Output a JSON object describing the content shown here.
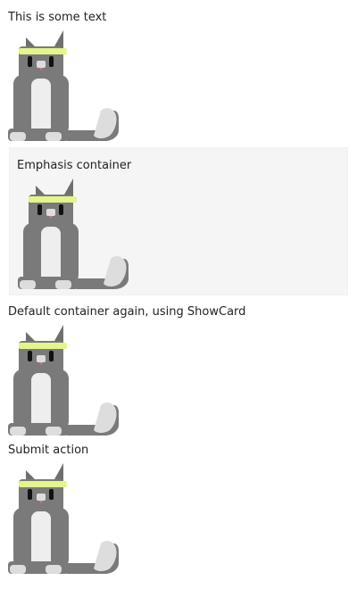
{
  "card": {
    "text_1": "This is some text",
    "emphasis": {
      "text": "Emphasis container"
    },
    "text_showcard": "Default container again, using ShowCard",
    "text_submit": "Submit action"
  },
  "images": [
    {
      "name": "cat"
    },
    {
      "name": "cat"
    },
    {
      "name": "cat"
    },
    {
      "name": "cat"
    }
  ],
  "colors": {
    "page_background": "#ffffff",
    "emphasis_background": "#f5f5f5",
    "headband": "#e3f58d",
    "cat_gray": "#7a7a7a",
    "cat_chest": "#eeeeee"
  }
}
